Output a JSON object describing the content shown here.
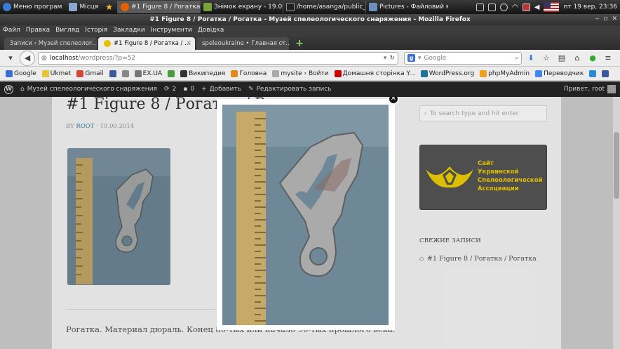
{
  "taskbar": {
    "menu_label": "Меню програм",
    "places_label": "Місця",
    "tasks": [
      {
        "label": "#1 Figure 8 / Рогатка / ..."
      },
      {
        "label": "Знімок екрану - 19.09...."
      },
      {
        "label": "/home/asanga/public_h..."
      },
      {
        "label": "Pictures - Файловий м..."
      }
    ],
    "clock": "пт 19 вер, 23:36"
  },
  "window": {
    "title": "#1 Figure 8 / Рогатка / Рогатка - Музей спелеологического снаряжения - Mozilla Firefox"
  },
  "menubar": {
    "items": [
      "Файл",
      "Правка",
      "Вигляд",
      "Історія",
      "Закладки",
      "Інструменти",
      "Довідка"
    ]
  },
  "tabs": [
    {
      "label": "Записи ‹ Музей спелеолог..."
    },
    {
      "label": "#1 Figure 8 / Рогатка / ..."
    },
    {
      "label": "speleoukraine • Главная ст..."
    }
  ],
  "navbar": {
    "url_host": "localhost",
    "url_path": "/wordpress/?p=52",
    "search_placeholder": "Google"
  },
  "bookmarks": [
    {
      "label": "Google",
      "color": "#3b6fd4"
    },
    {
      "label": "Ukmet",
      "color": "#e6c33a"
    },
    {
      "label": "Gmail",
      "color": "#d44638"
    },
    {
      "label": "",
      "color": "#3b5998"
    },
    {
      "label": "",
      "color": "#888888"
    },
    {
      "label": "EX.UA",
      "color": "#777777"
    },
    {
      "label": "",
      "color": "#4a9d3c"
    },
    {
      "label": "Википедия",
      "color": "#333333"
    },
    {
      "label": "Головна",
      "color": "#e08a1e"
    },
    {
      "label": "mysite › Войти",
      "color": "#aaaaaa"
    },
    {
      "label": "Домашня сторінка Y...",
      "color": "#cc0000"
    },
    {
      "label": "WordPress.org",
      "color": "#21759b"
    },
    {
      "label": "phpMyAdmin",
      "color": "#f0a020"
    },
    {
      "label": "Переводчик",
      "color": "#4285f4"
    },
    {
      "label": "",
      "color": "#2a8bd1"
    },
    {
      "label": "",
      "color": "#3b5998"
    }
  ],
  "wpbar": {
    "site_name": "Музей спелеологического снаряжения",
    "updates": "2",
    "comments": "0",
    "add_label": "Добавить",
    "edit_label": "Редактировать запись",
    "greeting": "Привет, root"
  },
  "post": {
    "title": "#1 Figure 8 / Рогатка / Рогатка",
    "meta_by": "BY",
    "author": "ROOT",
    "date": "19.09.2014",
    "excerpt": "Рогатка. Материал дюраль. Конец 80-тых или начало 90-тых прошлого века."
  },
  "sidebar": {
    "search_placeholder": "To search type and hit enter",
    "banner_lines": [
      "Сайт",
      "Украинской",
      "Спелеологической",
      "Ассоциации"
    ],
    "recent_heading": "СВЕЖИЕ ЗАПИСИ",
    "recent_item": "#1 Figure 8 / Рогатка / Рогатка"
  },
  "colors": {
    "accent_link": "#3a7fb0",
    "banner_text": "#f0d000",
    "wpbar_bg": "#222222"
  }
}
